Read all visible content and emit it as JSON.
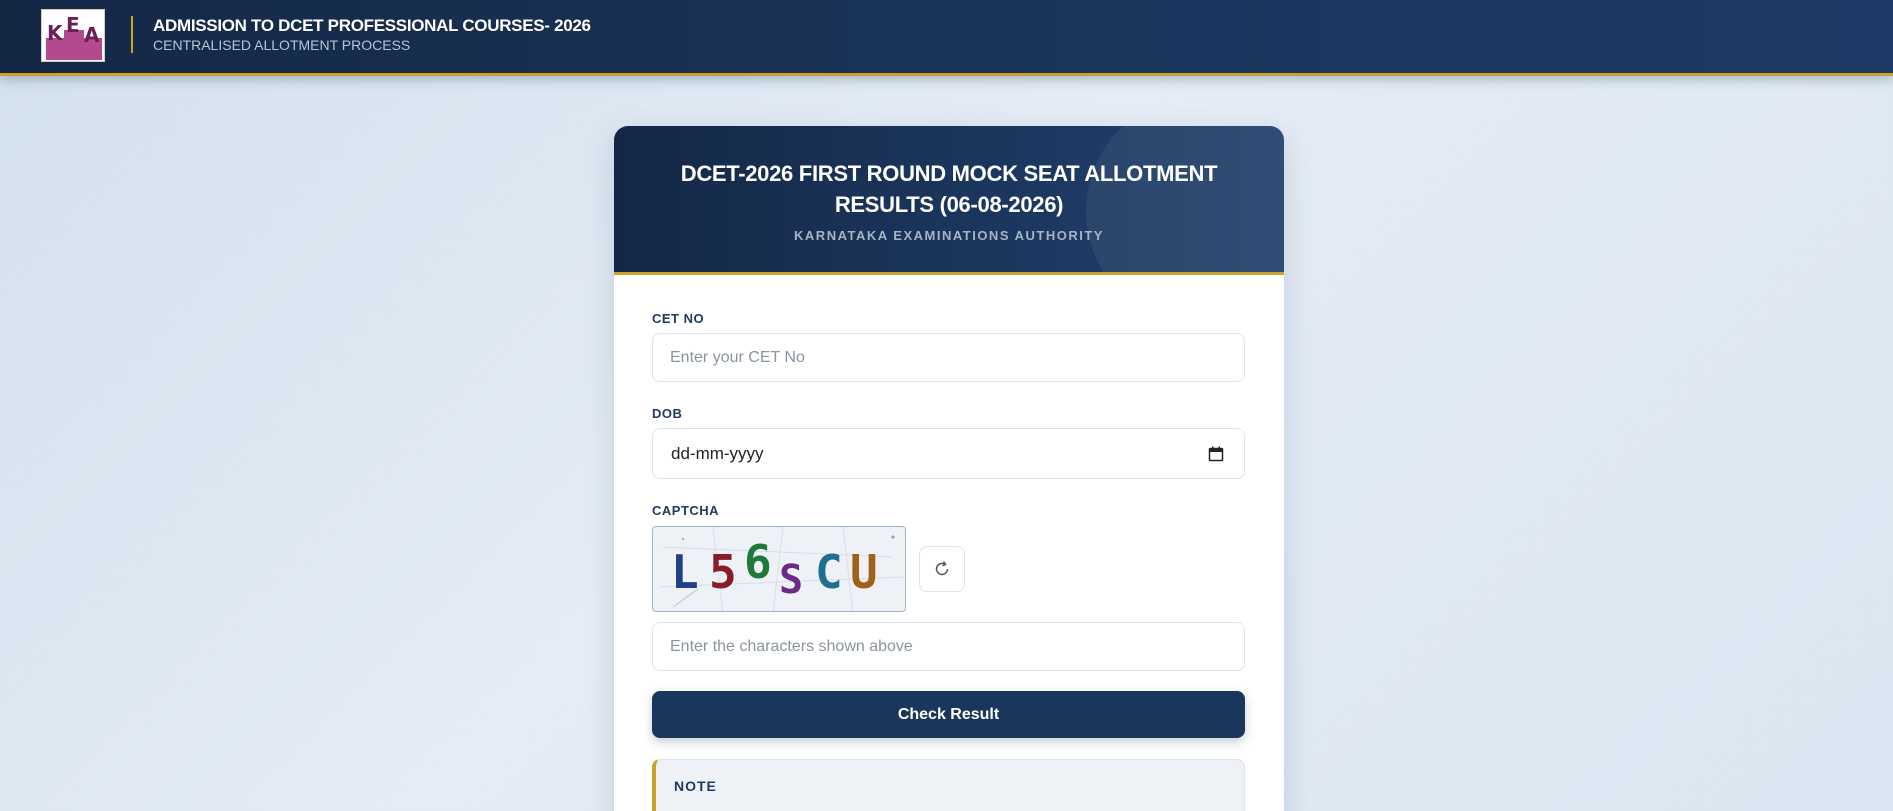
{
  "header": {
    "logo_text": "KEA",
    "title": "ADMISSION TO DCET PROFESSIONAL COURSES- 2026",
    "subtitle": "CENTRALISED ALLOTMENT PROCESS"
  },
  "card": {
    "title": "DCET-2026 FIRST ROUND MOCK SEAT ALLOTMENT RESULTS (06-08-2026)",
    "subtitle": "KARNATAKA EXAMINATIONS AUTHORITY"
  },
  "form": {
    "cet_label": "CET NO",
    "cet_placeholder": "Enter your CET No",
    "cet_value": "",
    "dob_label": "DOB",
    "dob_placeholder": "dd-mm-yyyy",
    "captcha_label": "CAPTCHA",
    "captcha_text": [
      "L",
      "5",
      "6",
      "S",
      "C",
      "U"
    ],
    "captcha_colors": [
      "#1f3f86",
      "#8a1c2a",
      "#1f7a3a",
      "#6b2a8a",
      "#1f6f8f",
      "#a0621a"
    ],
    "captcha_placeholder": "Enter the characters shown above",
    "captcha_value": "",
    "submit_label": "Check Result"
  },
  "note": {
    "title": "NOTE"
  },
  "colors": {
    "navy": "#1b365d",
    "gold": "#c9a227",
    "logo_magenta": "#b34a8f"
  },
  "icons": {
    "refresh": "refresh-icon",
    "calendar": "calendar-icon"
  }
}
